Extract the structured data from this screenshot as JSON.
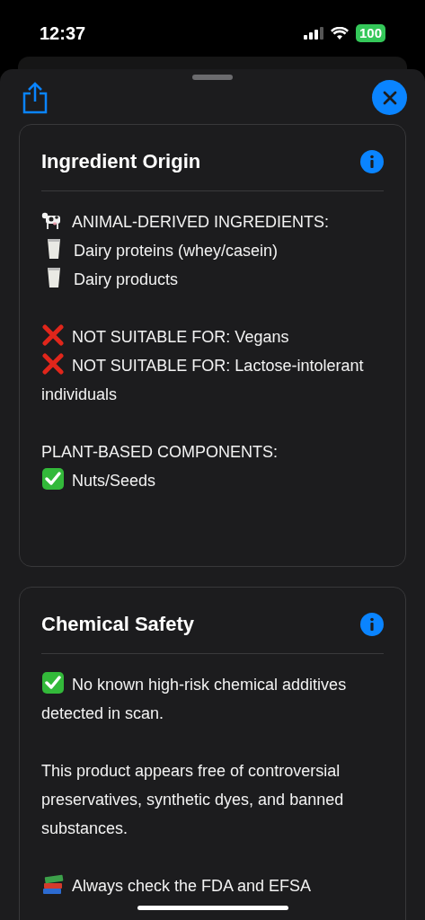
{
  "status_bar": {
    "time": "12:37",
    "battery": "100"
  },
  "cards": [
    {
      "title": "Ingredient Origin",
      "paragraphs": [
        {
          "items": [
            {
              "kind": "cow",
              "text": "ANIMAL-DERIVED INGREDIENTS:"
            },
            {
              "kind": "milk",
              "text": "Dairy proteins (whey/casein)"
            },
            {
              "kind": "milk",
              "text": "Dairy products"
            }
          ]
        },
        {
          "items": [
            {
              "kind": "cross",
              "text": "NOT SUITABLE FOR: Vegans"
            },
            {
              "kind": "cross",
              "text": "NOT SUITABLE FOR: Lactose-intolerant individuals"
            }
          ]
        },
        {
          "items": [
            {
              "kind": "plain",
              "text": "PLANT-BASED COMPONENTS:"
            },
            {
              "kind": "check",
              "text": "Nuts/Seeds"
            }
          ]
        }
      ]
    },
    {
      "title": "Chemical Safety",
      "paragraphs": [
        {
          "items": [
            {
              "kind": "check",
              "text": "No known high-risk chemical additives detected in scan."
            }
          ]
        },
        {
          "items": [
            {
              "kind": "plain",
              "text": "This product appears free of controversial preservatives, synthetic dyes, and banned substances."
            }
          ]
        },
        {
          "items": [
            {
              "kind": "books",
              "text": "Always check the FDA and EFSA"
            }
          ]
        }
      ]
    }
  ]
}
